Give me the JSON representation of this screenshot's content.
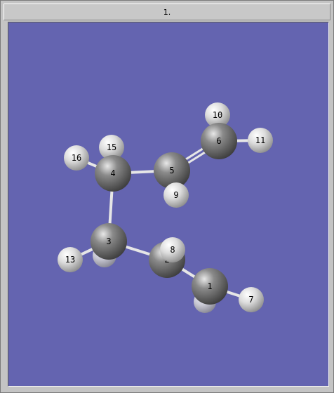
{
  "window": {
    "title": "1."
  },
  "colors": {
    "background": "#6464b0",
    "carbon": "#5a5a5a",
    "hydrogen": "#d8d8d8",
    "bond": "#e6e6e6"
  },
  "molecule": {
    "atoms": [
      {
        "id": "1",
        "element": "C"
      },
      {
        "id": "2",
        "element": "C"
      },
      {
        "id": "3",
        "element": "C"
      },
      {
        "id": "4",
        "element": "C"
      },
      {
        "id": "5",
        "element": "C"
      },
      {
        "id": "6",
        "element": "C"
      },
      {
        "id": "7",
        "element": "H"
      },
      {
        "id": "8",
        "element": "H"
      },
      {
        "id": "9",
        "element": "H"
      },
      {
        "id": "10",
        "element": "H"
      },
      {
        "id": "11",
        "element": "H"
      },
      {
        "id": "13",
        "element": "H"
      },
      {
        "id": "15",
        "element": "H"
      },
      {
        "id": "16",
        "element": "H"
      }
    ],
    "bonds": [
      {
        "a": "1",
        "b": "2",
        "order": 1
      },
      {
        "a": "2",
        "b": "3",
        "order": 1
      },
      {
        "a": "3",
        "b": "4",
        "order": 1
      },
      {
        "a": "4",
        "b": "5",
        "order": 1
      },
      {
        "a": "5",
        "b": "6",
        "order": 2
      },
      {
        "a": "1",
        "b": "7",
        "order": 1
      },
      {
        "a": "2",
        "b": "8",
        "order": 1
      },
      {
        "a": "5",
        "b": "9",
        "order": 1
      },
      {
        "a": "6",
        "b": "10",
        "order": 1
      },
      {
        "a": "6",
        "b": "11",
        "order": 1
      },
      {
        "a": "3",
        "b": "13",
        "order": 1
      },
      {
        "a": "4",
        "b": "15",
        "order": 1
      },
      {
        "a": "4",
        "b": "16",
        "order": 1
      }
    ]
  }
}
